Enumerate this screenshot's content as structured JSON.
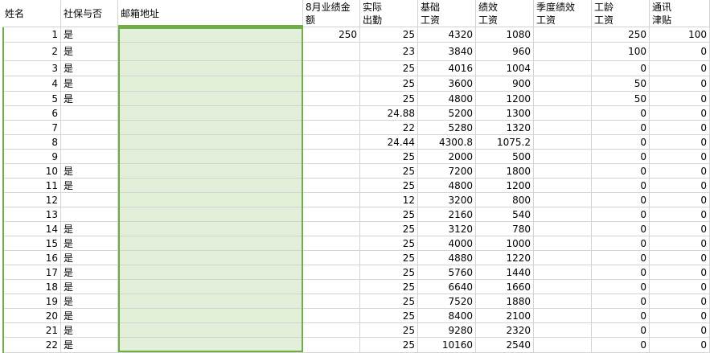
{
  "sheet": {
    "headers": {
      "name": [
        "姓名",
        ""
      ],
      "social": [
        "社保与否",
        ""
      ],
      "email": [
        "邮箱地址",
        ""
      ],
      "perf_aug": [
        "8月业绩金",
        "额"
      ],
      "attendance": [
        "实际",
        "出勤"
      ],
      "base": [
        "基础",
        "工资"
      ],
      "perf": [
        "绩效",
        "工资"
      ],
      "season": [
        "季度绩效",
        "工资"
      ],
      "seniority": [
        "工龄",
        "工资"
      ],
      "comm": [
        "通讯",
        "津贴"
      ]
    },
    "rows": [
      {
        "no": "1",
        "social": "是",
        "email": "",
        "perf_aug": "250",
        "attendance": "25",
        "base": "4320",
        "perf": "1080",
        "season": "",
        "seniority": "250",
        "comm": "100"
      },
      {
        "no": "2",
        "social": "是",
        "email": "",
        "perf_aug": "",
        "attendance": "23",
        "base": "3840",
        "perf": "960",
        "season": "",
        "seniority": "100",
        "comm": "0"
      },
      {
        "no": "3",
        "social": "是",
        "email": "",
        "perf_aug": "",
        "attendance": "25",
        "base": "4016",
        "perf": "1004",
        "season": "",
        "seniority": "0",
        "comm": "0"
      },
      {
        "no": "4",
        "social": "是",
        "email": "",
        "perf_aug": "",
        "attendance": "25",
        "base": "3600",
        "perf": "900",
        "season": "",
        "seniority": "50",
        "comm": "0"
      },
      {
        "no": "5",
        "social": "是",
        "email": "",
        "perf_aug": "",
        "attendance": "25",
        "base": "4800",
        "perf": "1200",
        "season": "",
        "seniority": "50",
        "comm": "0"
      },
      {
        "no": "6",
        "social": "",
        "email": "",
        "perf_aug": "",
        "attendance": "24.88",
        "base": "5200",
        "perf": "1300",
        "season": "",
        "seniority": "0",
        "comm": "0"
      },
      {
        "no": "7",
        "social": "",
        "email": "",
        "perf_aug": "",
        "attendance": "22",
        "base": "5280",
        "perf": "1320",
        "season": "",
        "seniority": "0",
        "comm": "0"
      },
      {
        "no": "8",
        "social": "",
        "email": "",
        "perf_aug": "",
        "attendance": "24.44",
        "base": "4300.8",
        "perf": "1075.2",
        "season": "",
        "seniority": "0",
        "comm": "0"
      },
      {
        "no": "9",
        "social": "",
        "email": "",
        "perf_aug": "",
        "attendance": "25",
        "base": "2000",
        "perf": "500",
        "season": "",
        "seniority": "0",
        "comm": "0"
      },
      {
        "no": "10",
        "social": "是",
        "email": "",
        "perf_aug": "",
        "attendance": "25",
        "base": "7200",
        "perf": "1800",
        "season": "",
        "seniority": "0",
        "comm": "0"
      },
      {
        "no": "11",
        "social": "是",
        "email": "",
        "perf_aug": "",
        "attendance": "25",
        "base": "4800",
        "perf": "1200",
        "season": "",
        "seniority": "0",
        "comm": "0"
      },
      {
        "no": "12",
        "social": "",
        "email": "",
        "perf_aug": "",
        "attendance": "12",
        "base": "3200",
        "perf": "800",
        "season": "",
        "seniority": "0",
        "comm": "0"
      },
      {
        "no": "13",
        "social": "",
        "email": "",
        "perf_aug": "",
        "attendance": "25",
        "base": "2160",
        "perf": "540",
        "season": "",
        "seniority": "0",
        "comm": "0"
      },
      {
        "no": "14",
        "social": "是",
        "email": "",
        "perf_aug": "",
        "attendance": "25",
        "base": "3120",
        "perf": "780",
        "season": "",
        "seniority": "0",
        "comm": "0"
      },
      {
        "no": "15",
        "social": "是",
        "email": "",
        "perf_aug": "",
        "attendance": "25",
        "base": "4000",
        "perf": "1000",
        "season": "",
        "seniority": "0",
        "comm": "0"
      },
      {
        "no": "16",
        "social": "是",
        "email": "",
        "perf_aug": "",
        "attendance": "25",
        "base": "4880",
        "perf": "1220",
        "season": "",
        "seniority": "0",
        "comm": "0"
      },
      {
        "no": "17",
        "social": "是",
        "email": "",
        "perf_aug": "",
        "attendance": "25",
        "base": "5760",
        "perf": "1440",
        "season": "",
        "seniority": "0",
        "comm": "0"
      },
      {
        "no": "18",
        "social": "是",
        "email": "",
        "perf_aug": "",
        "attendance": "25",
        "base": "6640",
        "perf": "1660",
        "season": "",
        "seniority": "0",
        "comm": "0"
      },
      {
        "no": "19",
        "social": "是",
        "email": "",
        "perf_aug": "",
        "attendance": "25",
        "base": "7520",
        "perf": "1880",
        "season": "",
        "seniority": "0",
        "comm": "0"
      },
      {
        "no": "20",
        "social": "是",
        "email": "",
        "perf_aug": "",
        "attendance": "25",
        "base": "8400",
        "perf": "2100",
        "season": "",
        "seniority": "0",
        "comm": "0"
      },
      {
        "no": "21",
        "social": "是",
        "email": "",
        "perf_aug": "",
        "attendance": "25",
        "base": "9280",
        "perf": "2320",
        "season": "",
        "seniority": "0",
        "comm": "0"
      },
      {
        "no": "22",
        "social": "是",
        "email": "",
        "perf_aug": "",
        "attendance": "25",
        "base": "10160",
        "perf": "2540",
        "season": "",
        "seniority": "0",
        "comm": "0"
      }
    ],
    "selection_color": "#70ad47",
    "selection_fill": "#e2f0d9"
  }
}
